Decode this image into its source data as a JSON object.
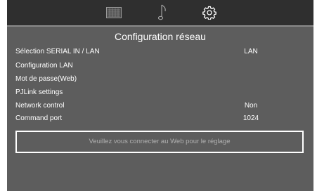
{
  "topbar": {
    "tabs": [
      {
        "icon": "display-grid-icon"
      },
      {
        "icon": "music-note-icon"
      },
      {
        "icon": "gear-icon"
      }
    ]
  },
  "menu": {
    "title": "Configuration réseau",
    "items": [
      {
        "label": "Sélection SERIAL IN / LAN",
        "value": "LAN"
      },
      {
        "label": "Configuration LAN",
        "value": ""
      },
      {
        "label": "Mot de passe(Web)",
        "value": ""
      },
      {
        "label": "PJLink settings",
        "value": ""
      },
      {
        "label": "Network control",
        "value": "Non"
      },
      {
        "label": "Command port",
        "value": "1024"
      }
    ]
  },
  "notice": "Veuillez vous connecter au Web pour le réglage",
  "colors": {
    "background": "#5d5d5d",
    "topbar": "#2f2f2f",
    "text": "#ffffff",
    "notice_text": "#b0b0b0"
  }
}
